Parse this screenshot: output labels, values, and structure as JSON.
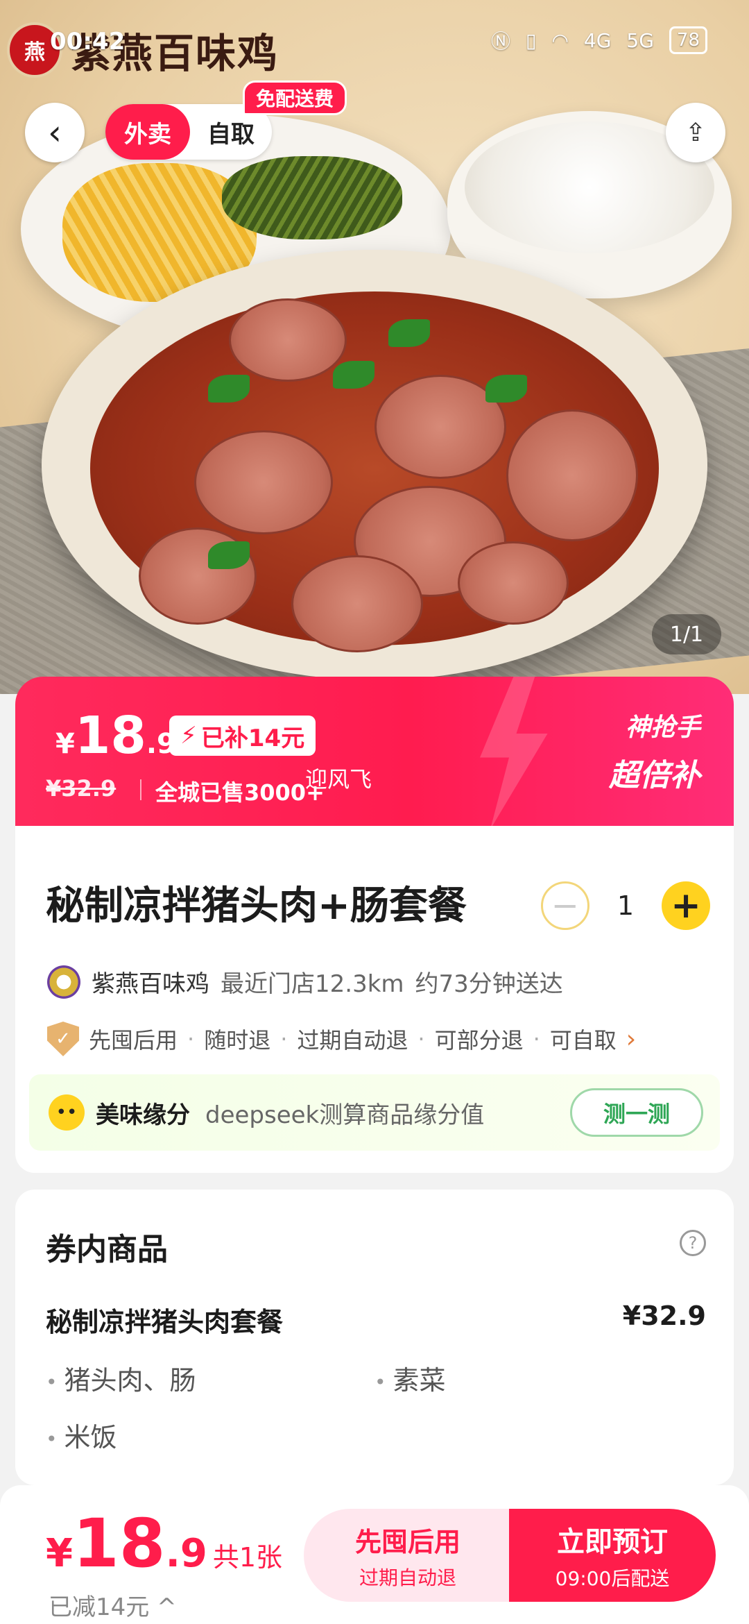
{
  "status": {
    "time": "00:42",
    "net": "4G",
    "net2": "5G",
    "battery": "78"
  },
  "brand": {
    "logo_text": "紫燕百味鸡"
  },
  "header": {
    "tab_delivery": "外卖",
    "tab_pickup": "自取",
    "free_delivery": "免配送费"
  },
  "gallery": {
    "pager": "1/1"
  },
  "price": {
    "currency": "¥",
    "integer": "18",
    "decimal": ".9",
    "subsidy": "已补14元",
    "original": "¥32.9",
    "sold": "全城已售3000+",
    "tag_line1": "神抢手",
    "tag_line2": "超倍补"
  },
  "watermark": "迎风飞",
  "product": {
    "title": "秘制凉拌猪头肉+肠套餐",
    "quantity": "1",
    "store_name": "紫燕百味鸡",
    "distance": "最近门店12.3km",
    "eta": "约73分钟送达",
    "guarantees": [
      "先囤后用",
      "随时退",
      "过期自动退",
      "可部分退",
      "可自取"
    ]
  },
  "fate": {
    "title": "美味缘分",
    "desc": "deepseek测算商品缘分值",
    "button": "测一测"
  },
  "contents": {
    "section_title": "券内商品",
    "set_name": "秘制凉拌猪头肉套餐",
    "set_price": "¥32.9",
    "items": [
      "猪头肉、肠",
      "素菜",
      "米饭"
    ]
  },
  "bottom": {
    "currency": "¥",
    "integer": "18",
    "decimal": ".9",
    "count": "共1张",
    "discount": "已减14元 ^",
    "left_title": "先囤后用",
    "left_sub": "过期自动退",
    "right_title": "立即预订",
    "right_sub": "09:00后配送"
  },
  "colors": {
    "accent": "#ff1d4b",
    "yellow": "#ffd21f",
    "green": "#2ea655"
  }
}
